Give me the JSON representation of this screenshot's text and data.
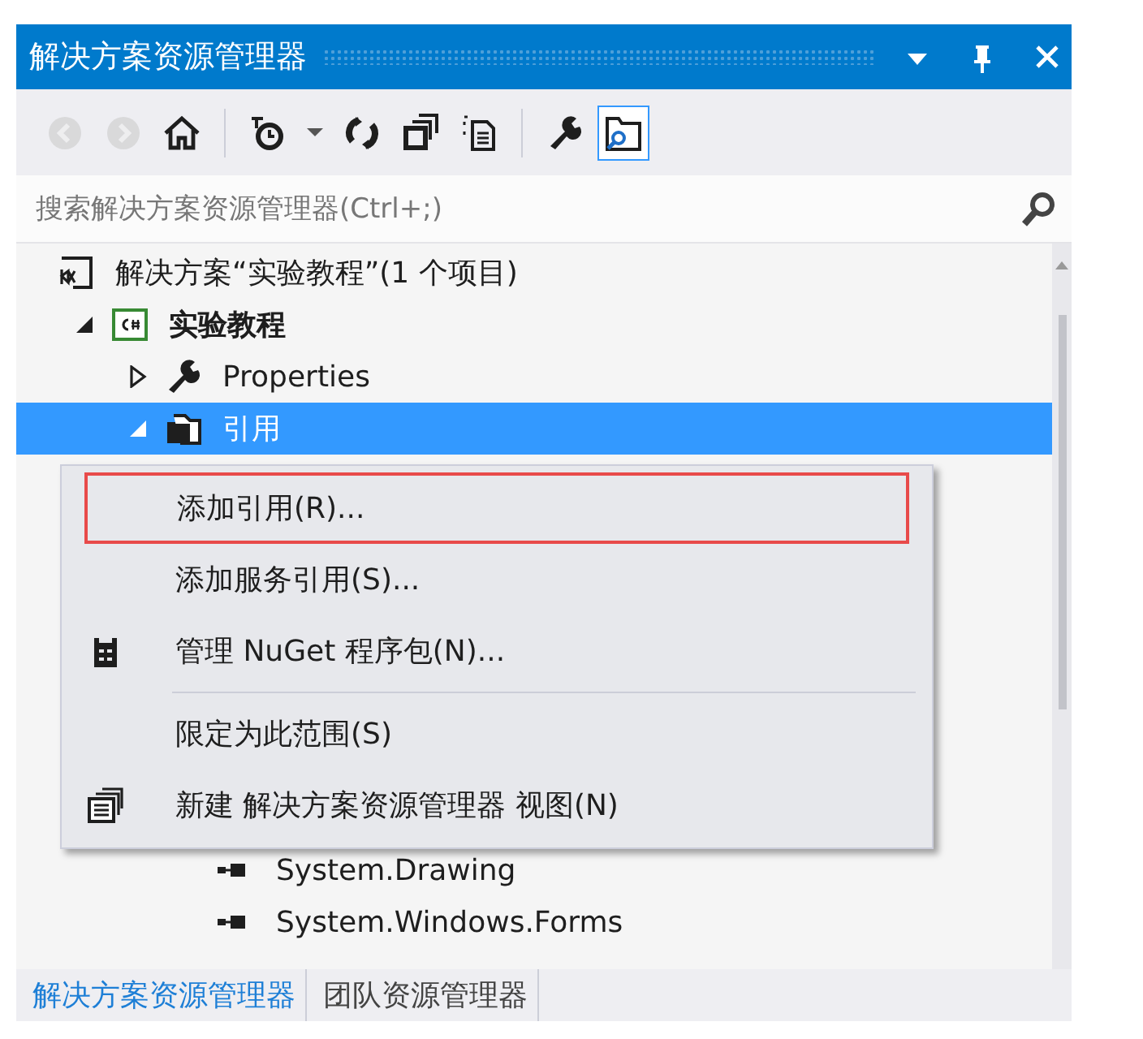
{
  "window": {
    "title": "解决方案资源管理器",
    "controls": [
      {
        "kind": "dropdown"
      },
      {
        "kind": "pin"
      },
      {
        "kind": "close"
      }
    ]
  },
  "toolbar": [
    {
      "kind": "back",
      "disabled": true,
      "selected": false
    },
    {
      "kind": "forward",
      "disabled": true,
      "selected": false
    },
    {
      "kind": "home",
      "disabled": false,
      "selected": false
    },
    {
      "kind": "separator"
    },
    {
      "kind": "history",
      "disabled": false,
      "selected": false
    },
    {
      "kind": "dropdown",
      "disabled": false,
      "selected": false
    },
    {
      "kind": "refresh",
      "disabled": false,
      "selected": false
    },
    {
      "kind": "collapse",
      "disabled": false,
      "selected": false
    },
    {
      "kind": "files",
      "disabled": false,
      "selected": false
    },
    {
      "kind": "separator"
    },
    {
      "kind": "properties",
      "disabled": false,
      "selected": false
    },
    {
      "kind": "preview",
      "disabled": false,
      "selected": true
    }
  ],
  "search": {
    "placeholder": "搜索解决方案资源管理器(Ctrl+;)"
  },
  "tree": [
    {
      "kind": "solution",
      "label": "解决方案“实验教程”(1 个项目)",
      "selected": false,
      "children": [
        {
          "kind": "project",
          "label": "实验教程",
          "selected": false,
          "expanded": true,
          "children": [
            {
              "kind": "properties",
              "label": "Properties",
              "selected": false,
              "expanded": false
            },
            {
              "kind": "references",
              "label": "引用",
              "selected": true,
              "expanded": true,
              "children": [
                {
                  "kind": "reference",
                  "label": "System.Drawing",
                  "selected": false
                },
                {
                  "kind": "reference",
                  "label": "System.Windows.Forms",
                  "selected": false
                }
              ]
            }
          ]
        }
      ]
    }
  ],
  "context_menu": [
    {
      "kind": "item",
      "label": "添加引用(R)...",
      "highlighted": true
    },
    {
      "kind": "item",
      "label": "添加服务引用(S)...",
      "highlighted": false
    },
    {
      "kind": "package",
      "label": "管理 NuGet 程序包(N)...",
      "highlighted": false
    },
    {
      "kind": "separator"
    },
    {
      "kind": "item",
      "label": "限定为此范围(S)",
      "highlighted": false
    },
    {
      "kind": "windows",
      "label": "新建 解决方案资源管理器 视图(N)",
      "highlighted": false
    }
  ],
  "tabs": [
    {
      "label": "解决方案资源管理器",
      "selected": true
    },
    {
      "label": "团队资源管理器",
      "selected": false
    }
  ]
}
